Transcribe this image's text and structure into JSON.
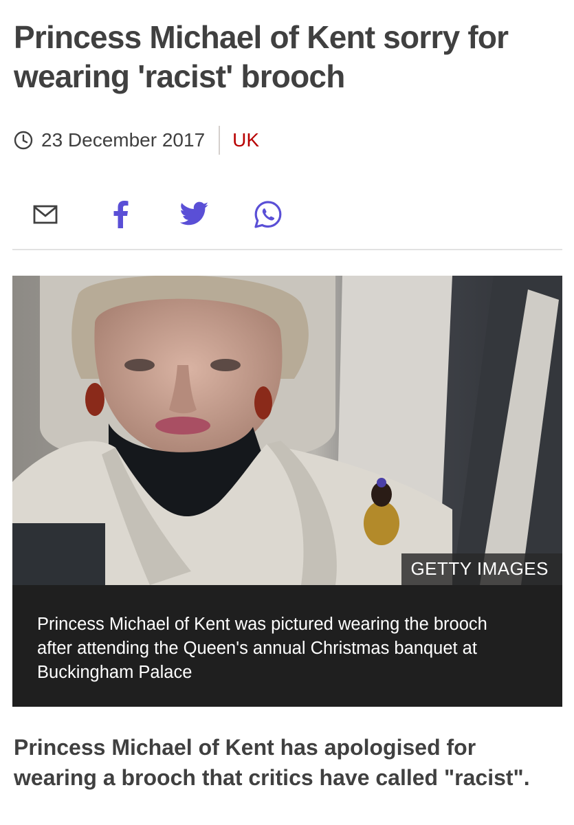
{
  "article": {
    "headline": "Princess Michael of Kent sorry for wearing 'racist' brooch",
    "date": "23 December 2017",
    "section": "UK",
    "intro": "Princess Michael of Kent has apologised for wearing a brooch that critics have called \"racist\"."
  },
  "share": {
    "icons": [
      "email-icon",
      "facebook-icon",
      "twitter-icon",
      "whatsapp-icon"
    ]
  },
  "image": {
    "credit": "GETTY IMAGES",
    "caption": "Princess Michael of Kent was pictured wearing the brooch after attending the Queen's annual Christmas banquet at Buckingham Palace"
  },
  "colors": {
    "section": "#b80000",
    "share_icons": "#5a4fd6",
    "text": "#404040",
    "caption_bg": "#1f1f1f"
  }
}
